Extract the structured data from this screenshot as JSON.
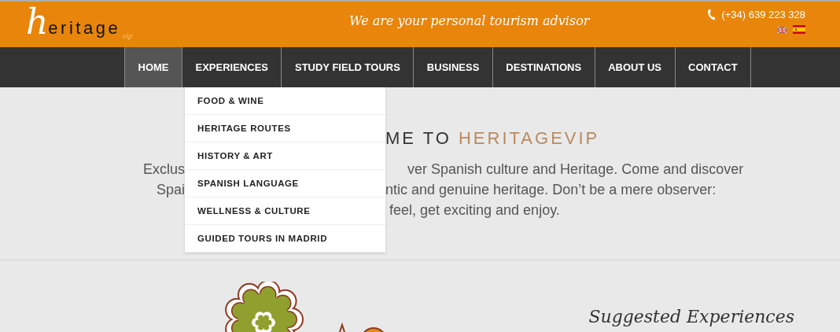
{
  "header": {
    "logo": {
      "initial": "h",
      "wordmark": "eritage",
      "suffix": "vip"
    },
    "tagline": "We are your personal tourism advisor",
    "phone": "(+34) 639 223 328",
    "languages": [
      {
        "kind": "uk",
        "selected": false
      },
      {
        "kind": "es",
        "selected": true
      }
    ]
  },
  "nav": [
    {
      "label": "HOME",
      "selected": true
    },
    {
      "label": "EXPERIENCES",
      "selected": false
    },
    {
      "label": "STUDY FIELD TOURS",
      "selected": false
    },
    {
      "label": "BUSINESS",
      "selected": false
    },
    {
      "label": "DESTINATIONS",
      "selected": false
    },
    {
      "label": "ABOUT US",
      "selected": false
    },
    {
      "label": "CONTACT",
      "selected": false
    }
  ],
  "dropdown": [
    "FOOD & WINE",
    "HERITAGE ROUTES",
    "HISTORY & ART",
    "SPANISH LANGUAGE",
    "WELLNESS & CULTURE",
    "GUIDED TOURS IN MADRID"
  ],
  "welcome": {
    "heading": "ME TO ",
    "brand": "HERITAGEVIP",
    "lines": [
      {
        "left": "Exclus",
        "right": "ver Spanish culture and Heritage. Come and discover"
      },
      {
        "left": "Spai",
        "right": "ntic and genuine heritage. Don’t be a mere observer:"
      },
      {
        "right": "feel, get exciting and enjoy."
      }
    ]
  },
  "suggested": {
    "title": "Suggested Experiences"
  }
}
